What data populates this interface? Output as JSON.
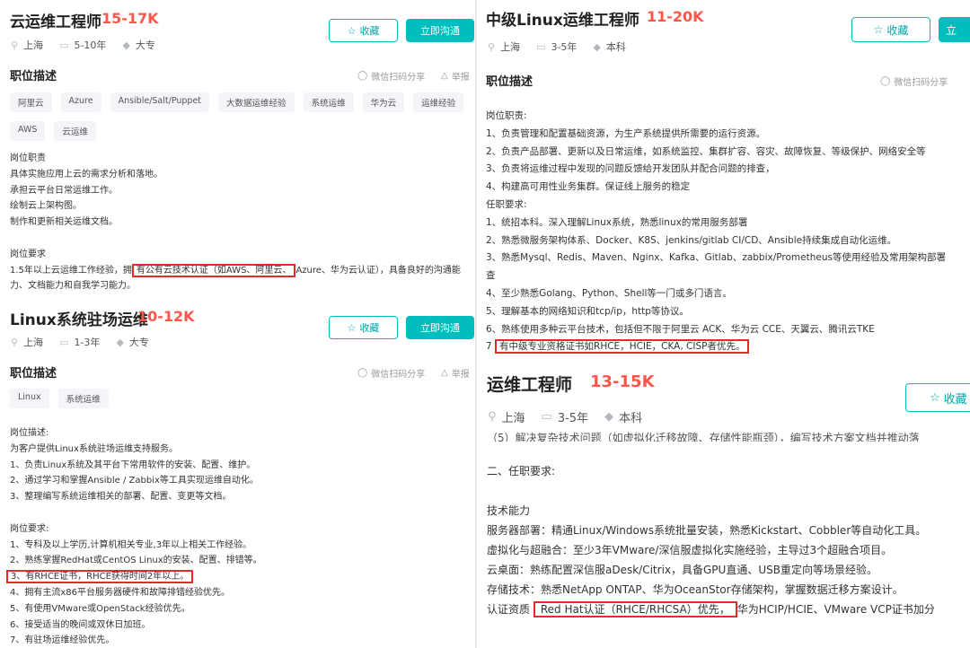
{
  "p1": {
    "title": "云运维工程师",
    "salary": "15-17K",
    "city": "上海",
    "exp": "5-10年",
    "edu": "大专",
    "fav": "收藏",
    "chat": "立即沟通",
    "section": "职位描述",
    "wechat": "微信扫码分享",
    "report": "举报",
    "tags": [
      "阿里云",
      "Azure",
      "Ansible/Salt/Puppet",
      "大数据运维经验",
      "系统运维",
      "华为云",
      "运维经验",
      "AWS",
      "云运维"
    ],
    "lines": [
      "岗位职责",
      "具体实施应用上云的需求分析和落地。",
      "承担云平台日常运维工作。",
      "绘制云上架构图。",
      "制作和更新相关运维文档。",
      "",
      "岗位要求"
    ],
    "req_pre": "1.5年以上云运维工作经验，拥",
    "req_hl": "有公有云技术认证（如AWS、阿里云、",
    "req_post": "Azure、华为云认证），具备良好的沟通能",
    "req_line2": "力、文档能力和自我学习能力。"
  },
  "p2": {
    "title": "Linux系统驻场运维",
    "salary": "10-12K",
    "city": "上海",
    "exp": "1-3年",
    "edu": "大专",
    "fav": "收藏",
    "chat": "立即沟通",
    "section": "职位描述",
    "wechat": "微信扫码分享",
    "report": "举报",
    "tags": [
      "Linux",
      "系统运维"
    ],
    "lines": [
      "岗位描述:",
      "为客户提供Linux系统驻场运维支持服务。",
      "1、负责Linux系统及其平台下常用软件的安装、配置、维护。",
      "2、通过学习和掌握Ansible / Zabbix等工具实现运维自动化。",
      "3、整理编写系统运维相关的部署、配置、变更等文档。",
      "",
      "岗位要求:",
      "1、专科及以上学历,计算机相关专业,3年以上相关工作经验。",
      "2、熟练掌握RedHat或CentOS Linux的安装、配置、排错等。"
    ],
    "hl_line": "3、有RHCE证书，RHCE获得时间2年以上。",
    "lines2": [
      "4、拥有主流x86平台服务器硬件和故障排错经验优先。",
      "5、有使用VMware或OpenStack经验优先。",
      "6、接受适当的晚间或双休日加班。",
      "7、有驻场运维经验优先。"
    ]
  },
  "p3": {
    "title": "中级Linux运维工程师",
    "salary": "11-20K",
    "city": "上海",
    "exp": "3-5年",
    "edu": "本科",
    "fav": "收藏",
    "chat": "立",
    "section": "职位描述",
    "wechat": "微信扫码分享",
    "lines": [
      "岗位职责:",
      "1、负责管理和配置基础资源，为生产系统提供所需要的运行资源。",
      "2、负责产品部署、更新以及日常运维，如系统监控、集群扩容、容灾、故障恢复、等级保护、网络安全等",
      "3、负责将运维过程中发现的问题反馈给开发团队并配合问题的排查，",
      "4、构建高可用性业务集群。保证线上服务的稳定",
      "任职要求:",
      "1、统招本科。深入理解Linux系统，熟悉linux的常用服务部署",
      "2、熟悉微服务架构体系、Docker、K8S、jenkins/gitlab CI/CD、Ansible持续集成自动化运维。",
      "3、熟悉Mysql、Redis、Maven、Nginx、Kafka、Gitlab、zabbix/Prometheus等使用经验及常用架构部署",
      "查",
      "4、至少熟悉Golang、Python、Shell等一门或多门语言。",
      "5、理解基本的网络知识和tcp/ip，http等协议。",
      "6、熟练使用多种云平台技术，包括但不限于阿里云 ACK、华为云 CCE、天翼云、腾讯云TKE"
    ],
    "hl_pre": "7",
    "hl_text": "有中级专业资格证书如RHCE，HCIE，CKA, CISP者优先。"
  },
  "p4": {
    "title": "运维工程师",
    "salary": "13-15K",
    "city": "上海",
    "exp": "3-5年",
    "edu": "本科",
    "fav": "收藏",
    "cut_line": "（5）解决复杂技术问题（如虚拟化迁移故障、存储性能瓶颈），编写技术方案文档并推动落",
    "sec2": "二、任职要求:",
    "lines": [
      "技术能力",
      "服务器部署：精通Linux/Windows系统批量安装，熟悉Kickstart、Cobbler等自动化工具。",
      "虚拟化与超融合：至少3年VMware/深信服虚拟化实施经验，主导过3个超融合项目。",
      "云桌面：熟练配置深信服aDesk/Citrix，具备GPU直通、USB重定向等场景经验。",
      "存储技术：熟悉NetApp ONTAP、华为OceanStor存储架构，掌握数据迁移方案设计。"
    ],
    "cert_pre": "认证资质",
    "cert_hl": "Red Hat认证（RHCE/RHCSA）优先，",
    "cert_post": "华为HCIP/HCIE、VMware VCP证书加分"
  }
}
